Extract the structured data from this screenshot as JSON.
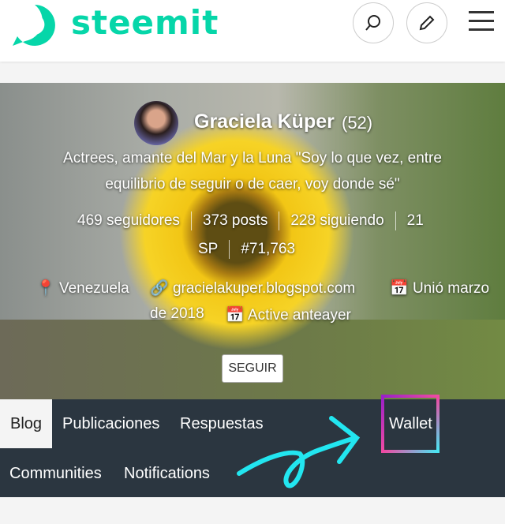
{
  "header": {
    "brand": "steemit",
    "icons": [
      "steemit-logo",
      "search-icon",
      "pencil-icon",
      "menu-icon"
    ]
  },
  "profile": {
    "name": "Graciela Küper",
    "reputation": "(52)",
    "bio_line1": "Actrees, amante del Mar y la Luna \"Soy lo que vez, entre",
    "bio_line2": "equilibrio de seguir o de caer, voy donde sé\"",
    "followers": "469 seguidores",
    "posts": "373 posts",
    "following": "228 siguiendo",
    "sp_a": "21",
    "sp_b": "SP",
    "rank": "#71,763",
    "location": "Venezuela",
    "website": "gracielakuper.blogspot.com",
    "joined_a": "Unió marzo",
    "joined_b": "de 2018",
    "active": "Active anteayer",
    "follow_button": "SEGUIR"
  },
  "nav": {
    "tabs": [
      "Blog",
      "Publicaciones",
      "Respuestas",
      "Wallet",
      "Communities",
      "Notifications"
    ],
    "active": "Blog"
  },
  "colors": {
    "brand": "#06d6a9",
    "nav_bg": "#2b3640",
    "annotation_arrow": "#22e6f0"
  }
}
